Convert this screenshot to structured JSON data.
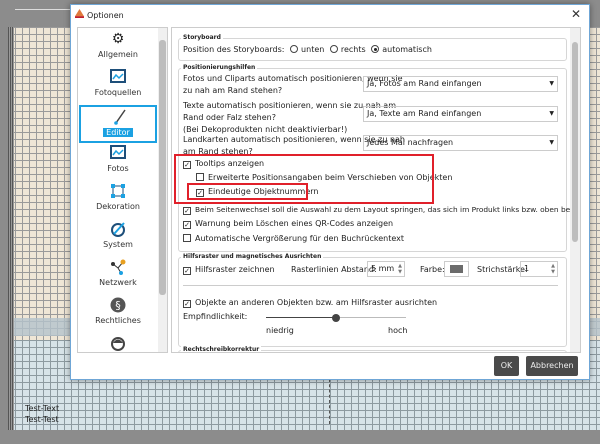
{
  "window": {
    "title": "Optionen",
    "close_icon": "close-icon"
  },
  "sidebar": {
    "items": [
      {
        "label": "Allgemein",
        "icon": "gear-icon"
      },
      {
        "label": "Fotoquellen",
        "icon": "image-icon"
      },
      {
        "label": "Editor",
        "icon": "brush-icon",
        "selected": true
      },
      {
        "label": "Fotos",
        "icon": "image-icon"
      },
      {
        "label": "Dekoration",
        "icon": "frame-icon"
      },
      {
        "label": "System",
        "icon": "system-icon"
      },
      {
        "label": "Netzwerk",
        "icon": "network-icon"
      },
      {
        "label": "Rechtliches",
        "icon": "paragraph-icon"
      },
      {
        "label": "",
        "icon": "support-icon"
      }
    ]
  },
  "storyboard": {
    "title": "Storyboard",
    "label": "Position des Storyboards:",
    "options": [
      "unten",
      "rechts",
      "automatisch"
    ],
    "selected": "automatisch"
  },
  "positioning": {
    "title": "Positionierungshilfen",
    "fotos": {
      "label1": "Fotos und Cliparts automatisch positionieren, wenn sie",
      "label2": "zu nah am Rand stehen?",
      "value": "Ja, Fotos am Rand einfangen"
    },
    "texte": {
      "label1": "Texte automatisch positionieren, wenn sie zu nah am",
      "label2": "Rand oder Falz stehen?",
      "label3": "(Bei Dekoprodukten nicht deaktivierbar!)",
      "value": "Ja, Texte am Rand einfangen"
    },
    "karten": {
      "label1": "Landkarten automatisch positionieren, wenn sie zu nah",
      "label2": "am Rand stehen?",
      "value": "Jedes Mal nachfragen"
    },
    "checks": [
      {
        "label": "Tooltips anzeigen",
        "checked": true
      },
      {
        "label": "Erweiterte Positionsangaben beim Verschieben von Objekten",
        "checked": false
      },
      {
        "label": "Eindeutige Objektnummern",
        "checked": true
      },
      {
        "label": "Beim Seitenwechsel soll die Auswahl zu dem Layout springen, das sich im Produkt links bzw. oben befindet.",
        "checked": true
      },
      {
        "label": "Warnung beim Löschen eines QR-Codes anzeigen",
        "checked": true
      },
      {
        "label": "Automatische Vergrößerung für den Buchrückentext",
        "checked": false
      }
    ]
  },
  "grid": {
    "title": "Hilfsraster und magnetisches Ausrichten",
    "draw": {
      "label": "Hilfsraster zeichnen",
      "checked": true
    },
    "spacing_label": "Rasterlinien Abstand:",
    "spacing_value": "5 mm",
    "color_label": "Farbe:",
    "color_value": "#6b6b6b",
    "stroke_label": "Strichstärke:",
    "stroke_value": "1",
    "snap": {
      "label": "Objekte an anderen Objekten bzw. am Hilfsraster ausrichten",
      "checked": true
    },
    "sensitivity_label": "Empfindlichkeit:",
    "sensitivity_value": 0.5,
    "low": "niedrig",
    "high": "hoch"
  },
  "spell": {
    "title": "Rechtschreibkorrektur"
  },
  "buttons": {
    "ok": "OK",
    "cancel": "Abbrechen"
  },
  "canvas": {
    "text1": "Test-Text",
    "text2": "Test-Test"
  },
  "colors": {
    "accent": "#1ba1e2",
    "highlight": "#e0202a",
    "button": "#4a4a4a"
  }
}
